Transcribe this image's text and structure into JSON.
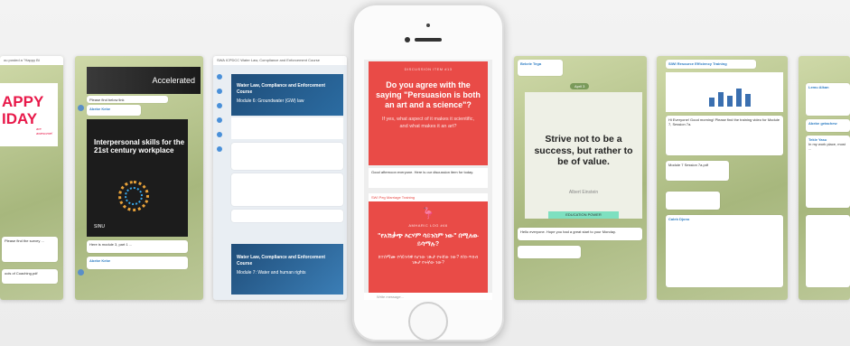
{
  "panel1": {
    "top_text": "ou posted a \"Happy Bi",
    "happy_text": "APPY\nIDAY",
    "happy_sub": "are awesome!",
    "msg1": "Please find the survey ...",
    "msg2": "ools of Coaching.pdf"
  },
  "panel2": {
    "accel_title": "Accelerated",
    "msg1": "Please find below link",
    "sender": "Abebe Kebe",
    "card_title": "Interpersonal skills for the 21st century workplace",
    "brand": "SINU",
    "caption": "Here is module 3, part 1 ...",
    "sender2": "Abebe Kebe"
  },
  "panel3": {
    "header": "SWA ICPDCC Water Law, Compliance and Enforcement Course",
    "card1_title": "Water Law, Compliance and Enforcement Course",
    "card1_sub": "Module 6: Groundwater (GW) law",
    "card2_title": "Water Law, Compliance and Enforcement Course",
    "card2_sub": "Module 7: Water and human rights"
  },
  "phone": {
    "card1_label": "DISCUSSION ITEM #13",
    "card1_question": "Do you agree with the saying \"Persuasion is both an art and a science\"?",
    "card1_sub": "If yes, what aspect of it makes it scientific, and what makes it an art?",
    "mid_msg": "Good afternoon everyone. Here is our discussion item for today.",
    "card2_header": "SWI Peg Marriage Training",
    "card2_label": "AMHARIC LOG #46",
    "card2_amharic": "\"የአሽቃጭ እርሃም ሳይንስም ነው\" በሚለው ይሳማሉ?",
    "card2_amharic_sub": "ከተሰማሙ የሳይንሳዊ የሆነው ገጽታ የትኛው ነው? የስነ-ጥበብ ገጽታ የትኛው ነው?",
    "compose": "Write message..."
  },
  "panel5": {
    "sender": "Bekele Tega",
    "date": "April 3",
    "quote": "Strive not to be a success, but rather to be of value.",
    "author": "Albert Einstein",
    "brand": "EDUCATION POWER",
    "msg": "Hello everyone. Hope you had a great start to your Monday."
  },
  "panel6": {
    "header": "SIWI Resource Efficiency Training",
    "doc_title": "Module 7 Session 7a.pdf",
    "msg": "Hi Everyone! Good morning! Please find the training video for Module 7, Session 7a.",
    "sender": "Caleb Djono"
  },
  "panel7": {
    "sender1": "Lemu Alkan",
    "sender2": "Abebe getachew",
    "sender3": "Tekle Yasu",
    "msg": "In my work place, most ..."
  }
}
